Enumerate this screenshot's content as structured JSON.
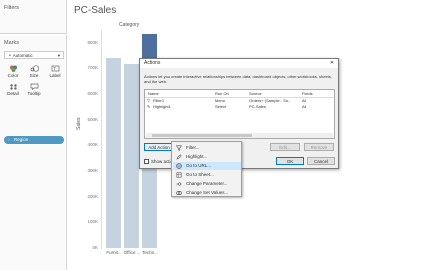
{
  "filters": {
    "title": "Filters"
  },
  "marks": {
    "title": "Marks",
    "mark_type": "Automatic",
    "cards": [
      "Color",
      "Size",
      "Label",
      "Detail",
      "Tooltip"
    ],
    "pill": "Region"
  },
  "chart": {
    "title": "PC-Sales",
    "header": "Category",
    "ylabel": "Sales"
  },
  "chart_data": {
    "type": "bar",
    "title": "PC-Sales",
    "xlabel": "Category",
    "ylabel": "Sales",
    "categories": [
      "Furnit...",
      "Office ...",
      "Techn..."
    ],
    "values": [
      742000,
      719000,
      836000
    ],
    "highlighted_index": 2,
    "y_ticks": [
      "0K",
      "100K",
      "200K",
      "300K",
      "400K",
      "500K",
      "600K",
      "700K",
      "800K"
    ],
    "ylim": [
      0,
      850000
    ],
    "colors": {
      "bar": "#c5d2df",
      "highlight": "#4f6f9f"
    }
  },
  "dialog": {
    "title": "Actions",
    "close": "✕",
    "description": "Actions let you create interactive relationships between data, dashboard objects, other workbooks, sheets, and the web.",
    "columns": [
      "Name",
      "Run On",
      "Source",
      "Fields"
    ],
    "rows": [
      {
        "name": "Filter1",
        "run_on": "Menu",
        "source": "Orders+ (Sample - Su...",
        "fields": "All"
      },
      {
        "name": "Highlight1",
        "run_on": "Select",
        "source": "PC-Sales",
        "fields": "All"
      }
    ],
    "add_action": "Add Action >",
    "edit": "Edit...",
    "remove": "Remove",
    "show_actions": "Show actions",
    "ok": "OK",
    "cancel": "Cancel"
  },
  "menu": {
    "items": [
      {
        "label": "Filter...",
        "icon": "filter-icon"
      },
      {
        "label": "Highlight...",
        "icon": "highlight-icon"
      },
      {
        "label": "Go to URL...",
        "icon": "url-icon"
      },
      {
        "label": "Go to Sheet...",
        "icon": "sheet-icon"
      },
      {
        "label": "Change Parameter...",
        "icon": "parameter-icon"
      },
      {
        "label": "Change Set Values...",
        "icon": "set-icon"
      }
    ],
    "selected_index": 2
  }
}
